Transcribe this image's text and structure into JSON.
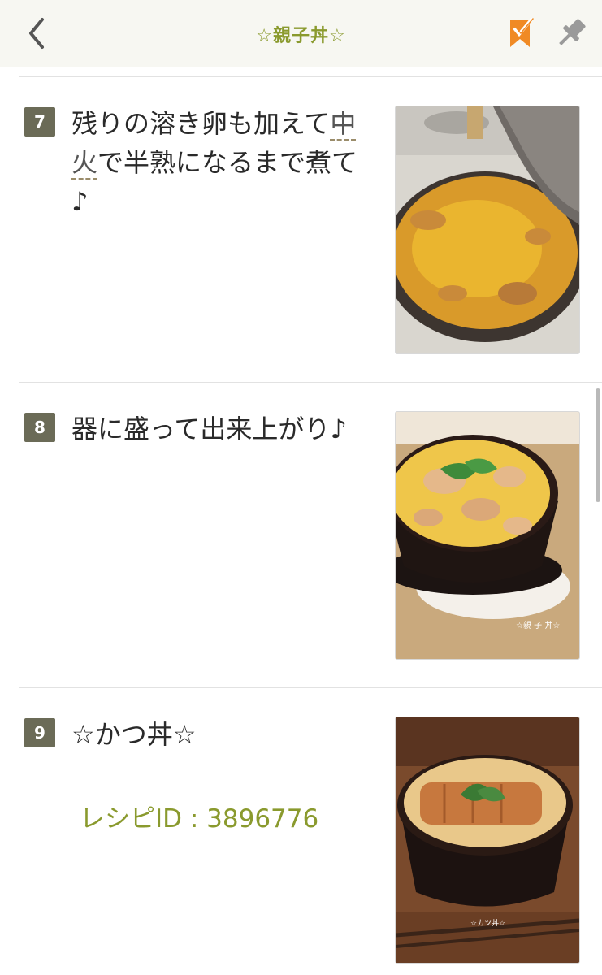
{
  "header": {
    "title": "☆親子丼☆",
    "back_icon": "chevron-left-icon",
    "bookmark_icon": "bookmark-icon",
    "pin_icon": "pin-icon",
    "accent_color": "#8a9a2e",
    "bookmark_color": "#f08a24"
  },
  "steps": [
    {
      "number": "7",
      "text_before": "残りの溶き卵も加えて",
      "text_link": "中火",
      "text_after": "で半熟になるまで煮て♪",
      "photo": "pan-with-egg-photo"
    },
    {
      "number": "8",
      "text": "器に盛って出来上がり♪",
      "photo": "oyakodon-bowl-photo",
      "photo_caption": "☆親 子 丼☆"
    },
    {
      "number": "9",
      "text": "☆かつ丼☆",
      "recipe_link": "レシピID : 3896776",
      "photo": "katsudon-bowl-photo",
      "photo_caption": "☆カツ丼☆"
    }
  ]
}
